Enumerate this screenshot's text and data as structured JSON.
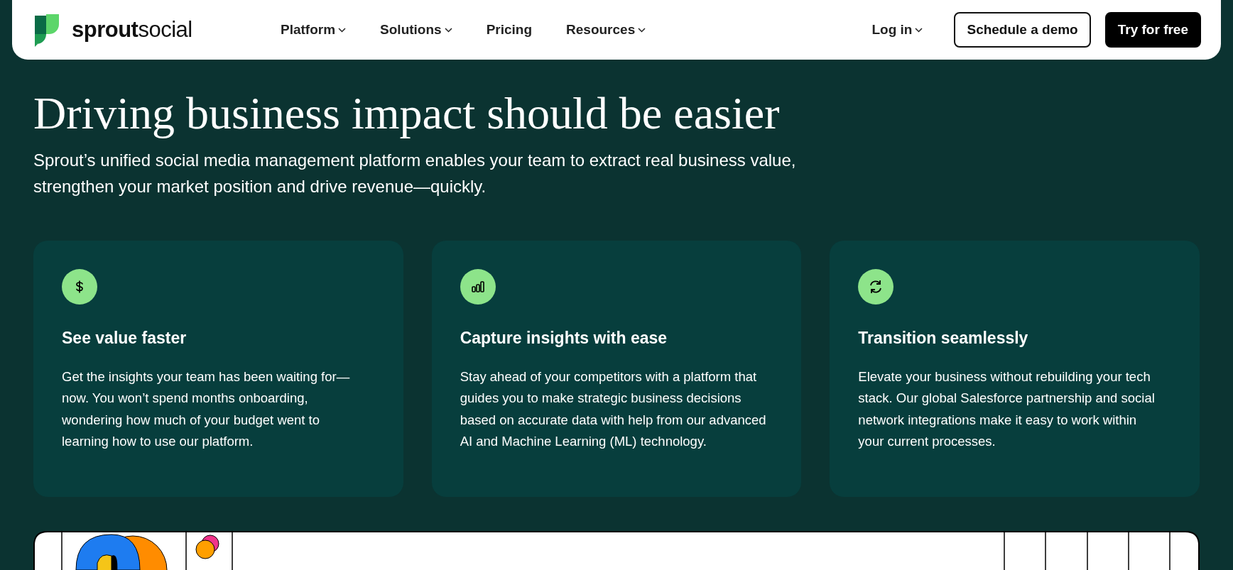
{
  "header": {
    "logo": "**sprout**social",
    "nav": [
      {
        "label": "Platform",
        "dropdown": true
      },
      {
        "label": "Solutions",
        "dropdown": true
      },
      {
        "label": "Pricing",
        "dropdown": false
      },
      {
        "label": "Resources",
        "dropdown": true
      }
    ],
    "login": {
      "label": "Log in",
      "dropdown": true
    },
    "buttons": [
      {
        "label": "Schedule a demo",
        "kind": "outline"
      },
      {
        "label": "Try for free",
        "kind": "solid"
      }
    ]
  },
  "hero": {
    "title": "Driving business impact should be easier",
    "subtitle": "Sprout’s unified social media management platform enables your team to extract real business value, strengthen your market position and drive revenue—quickly."
  },
  "cards": [
    {
      "title": "See value faster",
      "text": "Get the insights your team has been waiting for—now. You won’t spend months onboarding, wondering how much of your budget went to learning how to use our platform."
    },
    {
      "title": "Capture insights with ease",
      "text": "Stay ahead of your competitors with a platform that guides you to make strategic business decisions based on accurate data with help from our advanced AI and Machine Learning (ML) technology."
    },
    {
      "title": "Transition seamlessly",
      "text": "Elevate your business without rebuilding your tech stack. Our global Salesforce partnership and social network integrations make it easy to work within your current processes."
    }
  ]
}
